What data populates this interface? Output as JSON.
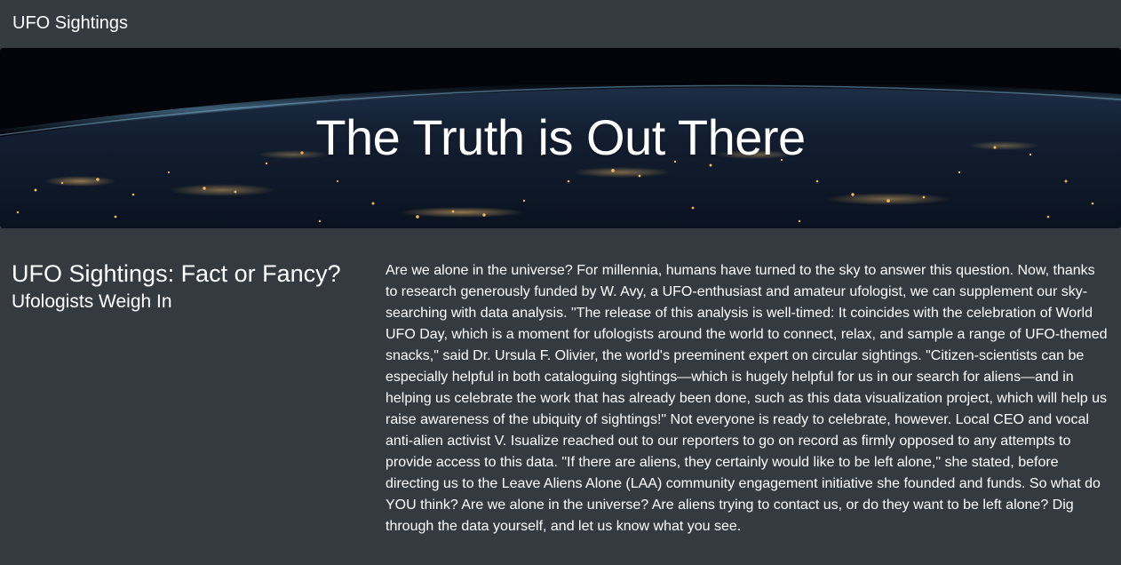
{
  "navbar": {
    "brand": "UFO Sightings"
  },
  "hero": {
    "title": "The Truth is Out There"
  },
  "sidebar": {
    "heading": "UFO Sightings: Fact or Fancy?",
    "subheading": "Ufologists Weigh In"
  },
  "article": {
    "body": "Are we alone in the universe? For millennia, humans have turned to the sky to answer this question. Now, thanks to research generously funded by W. Avy, a UFO-enthusiast and amateur ufologist, we can supplement our sky-searching with data analysis. \"The release of this analysis is well-timed: It coincides with the celebration of World UFO Day, which is a moment for ufologists around the world to connect, relax, and sample a range of UFO-themed snacks,\" said Dr. Ursula F. Olivier, the world's preeminent expert on circular sightings. \"Citizen-scientists can be especially helpful in both cataloguing sightings—which is hugely helpful for us in our search for aliens—and in helping us celebrate the work that has already been done, such as this data visualization project, which will help us raise awareness of the ubiquity of sightings!\" Not everyone is ready to celebrate, however. Local CEO and vocal anti-alien activist V. Isualize reached out to our reporters to go on record as firmly opposed to any attempts to provide access to this data. \"If there are aliens, they certainly would like to be left alone,\" she stated, before directing us to the Leave Aliens Alone (LAA) community engagement initiative she founded and funds. So what do YOU think? Are we alone in the universe? Are aliens trying to contact us, or do they want to be left alone? Dig through the data yourself, and let us know what you see."
  },
  "colors": {
    "background": "#343a40",
    "text": "#ffffff",
    "city_lights": "#f3b45a",
    "atmosphere": "#6aa2c8"
  }
}
